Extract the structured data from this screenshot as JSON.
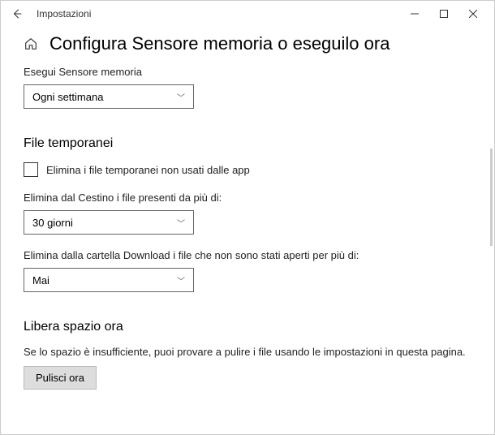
{
  "window": {
    "title": "Impostazioni"
  },
  "page": {
    "heading": "Configura Sensore memoria o eseguilo ora",
    "run_label": "Esegui Sensore memoria",
    "run_dropdown": "Ogni settimana"
  },
  "temp": {
    "heading": "File temporanei",
    "checkbox_label": "Elimina i file temporanei non usati dalle app",
    "recycle_label": "Elimina dal Cestino i file presenti da più di:",
    "recycle_value": "30 giorni",
    "downloads_label": "Elimina dalla cartella Download i file che non sono stati aperti per più di:",
    "downloads_value": "Mai"
  },
  "free": {
    "heading": "Libera spazio ora",
    "info": "Se lo spazio è insufficiente, puoi provare a pulire i file usando le impostazioni in questa pagina.",
    "button": "Pulisci ora"
  }
}
